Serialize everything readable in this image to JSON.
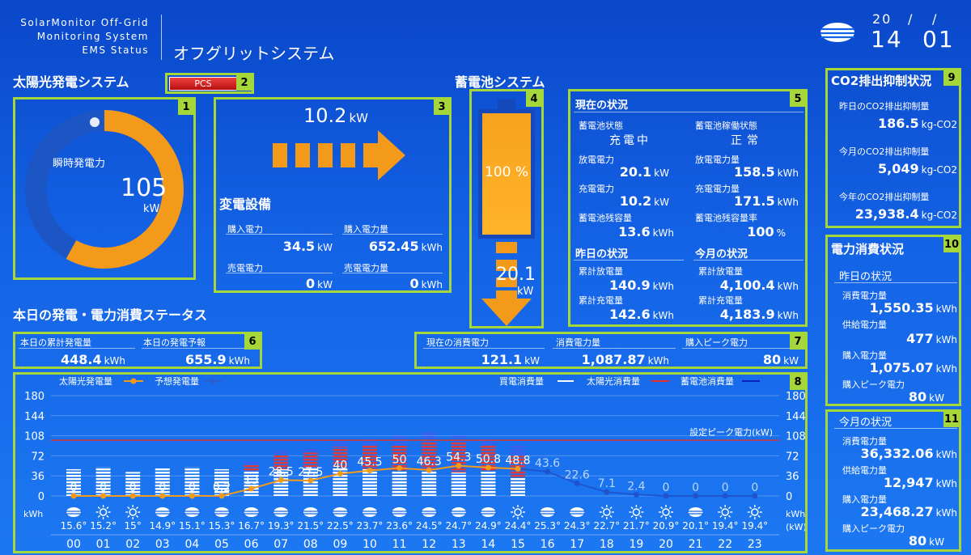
{
  "header": {
    "brand_line1": "SolarMonitor Off-Grid",
    "brand_line2": "Monitoring System",
    "brand_line3": "EMS Status",
    "title": "オフグリットシステム",
    "date_prefix": "20",
    "date_sep1": "/",
    "date_sep2": "/",
    "time_h": "14",
    "time_m": "01",
    "weather_icon": "cloud-icon"
  },
  "solar": {
    "title": "太陽光発電システム",
    "pcs_label": "PCS",
    "gauge_label": "瞬時発電力",
    "gauge_value": "105",
    "gauge_unit": "kW",
    "gauge_fraction": 0.58
  },
  "transformer": {
    "flow_value": "10.2",
    "flow_unit": "kW",
    "title": "変電設備",
    "buy_power_label": "購入電力",
    "buy_power_value": "34.5",
    "buy_power_unit": "kW",
    "buy_energy_label": "購入電力量",
    "buy_energy_value": "652.45",
    "buy_energy_unit": "kWh",
    "sell_power_label": "売電電力",
    "sell_power_value": "0",
    "sell_power_unit": "kW",
    "sell_energy_label": "売電電力量",
    "sell_energy_value": "0",
    "sell_energy_unit": "kWh"
  },
  "battery": {
    "title": "蓄電池システム",
    "level_text": "100 %",
    "level_fraction": 1.0,
    "out_value": "20.1",
    "out_unit": "kW"
  },
  "status": {
    "current_title": "現在の状況",
    "state_label": "蓄電池状態",
    "state_value": "充電中",
    "operation_label": "蓄電池稼働状態",
    "operation_value": "正常",
    "discharge_power_label": "放電電力",
    "discharge_power_value": "20.1",
    "discharge_power_unit": "kW",
    "discharge_energy_label": "放電電力量",
    "discharge_energy_value": "158.5",
    "discharge_energy_unit": "kWh",
    "charge_power_label": "充電電力",
    "charge_power_value": "10.2",
    "charge_power_unit": "kW",
    "charge_energy_label": "充電電力量",
    "charge_energy_value": "171.5",
    "charge_energy_unit": "kWh",
    "remain_label": "蓄電池残容量",
    "remain_value": "13.6",
    "remain_unit": "kWh",
    "remain_rate_label": "蓄電池残容量率",
    "remain_rate_value": "100",
    "remain_rate_unit": "%",
    "yesterday_title": "昨日の状況",
    "month_title": "今月の状況",
    "y_discharge_label": "累計放電量",
    "y_discharge_value": "140.9",
    "y_discharge_unit": "kWh",
    "y_charge_label": "累計充電量",
    "y_charge_value": "142.6",
    "y_charge_unit": "kWh",
    "m_discharge_label": "累計放電量",
    "m_discharge_value": "4,100.4",
    "m_discharge_unit": "kWh",
    "m_charge_label": "累計充電量",
    "m_charge_value": "4,183.9",
    "m_charge_unit": "kWh"
  },
  "today": {
    "title": "本日の発電・電力消費ステータス",
    "gen_label": "本日の累計発電量",
    "gen_value": "448.4",
    "gen_unit": "kWh",
    "forecast_label": "本日の発電予報",
    "forecast_value": "655.9",
    "forecast_unit": "kWh",
    "cur_cons_label": "現在の消費電力",
    "cur_cons_value": "121.1",
    "cur_cons_unit": "kW",
    "cons_energy_label": "消費電力量",
    "cons_energy_value": "1,087.87",
    "cons_energy_unit": "kWh",
    "peak_label": "購入ピーク電力",
    "peak_value": "80",
    "peak_unit": "kW"
  },
  "co2": {
    "title": "CO2排出抑制状況",
    "y_label": "昨日のCO2排出抑制量",
    "y_value": "186.5",
    "y_unit": "kg-CO2",
    "m_label": "今月のCO2排出抑制量",
    "m_value": "5,049",
    "m_unit": "kg-CO2",
    "yr_label": "今年のCO2排出抑制量",
    "yr_value": "23,938.4",
    "yr_unit": "kg-CO2"
  },
  "consumption": {
    "title": "電力消費状況",
    "yesterday_title": "昨日の状況",
    "y_cons_label": "消費電力量",
    "y_cons_value": "1,550.35",
    "y_cons_unit": "kWh",
    "y_supply_label": "供給電力量",
    "y_supply_value": "477",
    "y_supply_unit": "kWh",
    "y_buy_label": "購入電力量",
    "y_buy_value": "1,075.07",
    "y_buy_unit": "kWh",
    "y_peak_label": "購入ピーク電力",
    "y_peak_value": "80",
    "y_peak_unit": "kW"
  },
  "month": {
    "title": "今月の状況",
    "cons_label": "消費電力量",
    "cons_value": "36,332.06",
    "cons_unit": "kWh",
    "supply_label": "供給電力量",
    "supply_value": "12,947",
    "supply_unit": "kWh",
    "buy_label": "購入電力量",
    "buy_value": "23,468.27",
    "buy_unit": "kWh",
    "peak_label": "購入ピーク電力",
    "peak_value": "80",
    "peak_unit": "kW"
  },
  "badges": [
    "1",
    "2",
    "3",
    "4",
    "5",
    "6",
    "7",
    "8",
    "9",
    "10",
    "11"
  ],
  "chart_data": {
    "type": "bar",
    "legend_left": [
      "太陽光発電量",
      "予想発電量"
    ],
    "legend_right": [
      "買電消費量",
      "太陽光消費量",
      "蓄電池消費量"
    ],
    "ylabel_left": "kWh",
    "ylabel_right_1": "kWh",
    "ylabel_right_2": "(kW)",
    "ylim": [
      0,
      180
    ],
    "yticks": [
      0,
      36,
      72,
      108,
      144,
      180
    ],
    "peak_line_value": 100,
    "peak_line_label": "設定ピーク電力(kW)",
    "categories": [
      "00",
      "01",
      "02",
      "03",
      "04",
      "05",
      "06",
      "07",
      "08",
      "09",
      "10",
      "11",
      "12",
      "13",
      "14",
      "15",
      "16",
      "17",
      "18",
      "19",
      "20",
      "21",
      "22",
      "23"
    ],
    "purchase": [
      48,
      52,
      43,
      50,
      52,
      48,
      45,
      48,
      52,
      50,
      48,
      45,
      46,
      42,
      45,
      32,
      0,
      0,
      0,
      0,
      0,
      0,
      0,
      0
    ],
    "solar_cons": [
      0,
      0,
      0,
      0,
      0,
      0,
      12,
      26,
      26,
      38,
      42,
      46,
      50,
      54,
      45,
      40,
      0,
      0,
      0,
      0,
      0,
      0,
      0,
      0
    ],
    "battery_cons": [
      0,
      0,
      0,
      0,
      0,
      0,
      4,
      8,
      8,
      12,
      14,
      16,
      20,
      12,
      12,
      20,
      0,
      0,
      0,
      0,
      0,
      0,
      0,
      0
    ],
    "solar_gen_labels": [
      "0",
      "0",
      "0",
      "0",
      "0",
      "0.2",
      "13",
      "28.5",
      "27.5",
      "40",
      "45.5",
      "50",
      "46.3",
      "54.3",
      "50.8",
      "48.8",
      "",
      "",
      "",
      "",
      "",
      "",
      "",
      ""
    ],
    "solar_gen": [
      0,
      0,
      0,
      0,
      0,
      0.2,
      13,
      28.5,
      27.5,
      40,
      45.5,
      50,
      46.3,
      54.3,
      50.8,
      48.8
    ],
    "forecast": [
      null,
      null,
      null,
      null,
      null,
      null,
      null,
      null,
      null,
      null,
      null,
      null,
      null,
      null,
      null,
      48.8,
      43.6,
      22.6,
      7.1,
      2.4,
      0,
      0,
      0,
      0
    ],
    "forecast_labels": [
      "",
      "",
      "",
      "",
      "",
      "",
      "",
      "",
      "",
      "",
      "",
      "",
      "",
      "",
      "",
      "",
      "43.6",
      "22.6",
      "7.1",
      "2.4",
      "0",
      "0",
      "0",
      "0"
    ],
    "weather": [
      "cloud",
      "sun",
      "sun",
      "cloud",
      "cloud",
      "cloud",
      "cloud",
      "cloud",
      "cloud",
      "cloud",
      "cloud",
      "cloud",
      "cloud",
      "cloud",
      "cloud",
      "sun",
      "cloud",
      "cloud",
      "sun",
      "sun",
      "sun",
      "cloud",
      "sun",
      "sun"
    ],
    "temps": [
      "15.6°",
      "15.2°",
      "15°",
      "14.9°",
      "15.1°",
      "15.3°",
      "16.7°",
      "19.3°",
      "21.5°",
      "22.5°",
      "23.7°",
      "23.6°",
      "24.5°",
      "24.7°",
      "24.9°",
      "24.4°",
      "25.3°",
      "24.3°",
      "22.7°",
      "21.7°",
      "20.9°",
      "20.1°",
      "19.4°",
      "19.4°"
    ]
  }
}
